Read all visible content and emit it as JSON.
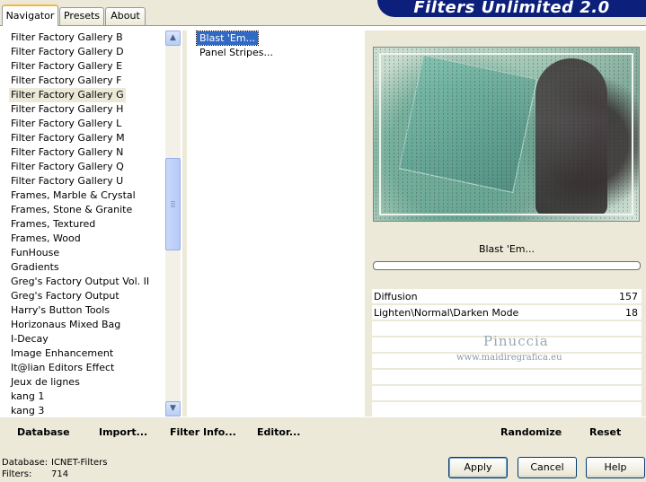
{
  "tabs": [
    {
      "label": "Navigator"
    },
    {
      "label": "Presets"
    },
    {
      "label": "About"
    }
  ],
  "banner": {
    "title": "Filters Unlimited 2.0"
  },
  "categories": [
    "Filter Factory Gallery B",
    "Filter Factory Gallery D",
    "Filter Factory Gallery E",
    "Filter Factory Gallery F",
    "Filter Factory Gallery G",
    "Filter Factory Gallery H",
    "Filter Factory Gallery L",
    "Filter Factory Gallery M",
    "Filter Factory Gallery N",
    "Filter Factory Gallery Q",
    "Filter Factory Gallery U",
    "Frames, Marble & Crystal",
    "Frames, Stone & Granite",
    "Frames, Textured",
    "Frames, Wood",
    "FunHouse",
    "Gradients",
    "Greg's Factory Output Vol. II",
    "Greg's Factory Output",
    "Harry's Button Tools",
    "Horizonaus Mixed Bag",
    "I-Decay",
    "Image Enhancement",
    "It@lian Editors Effect",
    "Jeux de lignes",
    "kang 1",
    "kang 3"
  ],
  "selected_category": "Filter Factory Gallery G",
  "effects": [
    "Blast 'Em...",
    "Panel Stripes..."
  ],
  "selected_effect": "Blast 'Em...",
  "effect_title": "Blast 'Em...",
  "parameters": [
    {
      "name": "Diffusion",
      "value": "157"
    },
    {
      "name": "Lighten\\Normal\\Darken Mode",
      "value": "18"
    }
  ],
  "watermark": {
    "name": "Pinuccia",
    "url": "www.maidiregrafica.eu"
  },
  "links": {
    "database": "Database",
    "import": "Import...",
    "filter_info": "Filter Info...",
    "editor": "Editor...",
    "randomize": "Randomize",
    "reset": "Reset"
  },
  "status": {
    "database_label": "Database:",
    "database_value": "ICNET-Filters",
    "filters_label": "Filters:",
    "filters_value": "714"
  },
  "buttons": {
    "apply": "Apply",
    "cancel": "Cancel",
    "help": "Help"
  },
  "icons": {
    "scroll_up": "arrow-up-icon",
    "scroll_down": "arrow-down-icon"
  },
  "colors": {
    "banner": "#0c1f7a",
    "selection": "#316ac5",
    "tab_highlight": "#f6b73c"
  }
}
